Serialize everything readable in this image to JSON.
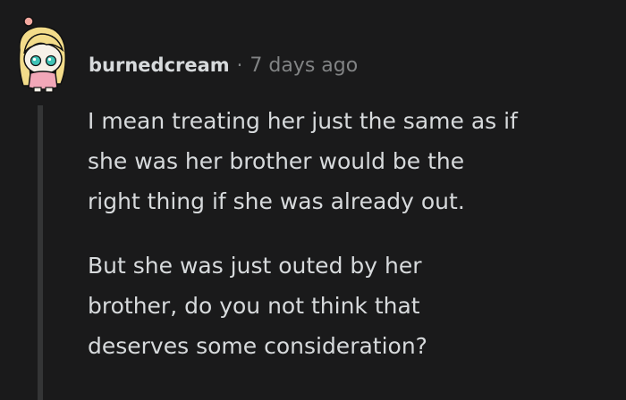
{
  "comment": {
    "author": "burnedcream",
    "separator": "·",
    "timestamp": "7 days ago",
    "avatar_icon": "snoo-avatar-blonde-icon",
    "paragraphs": [
      [
        "I mean treating her just the same as if",
        "she was her brother would be the",
        "right thing if she was already out."
      ],
      [
        "But she was just outed by her",
        "brother, do you not think that",
        "deserves some consideration?"
      ]
    ]
  },
  "colors": {
    "background": "#1a1a1b",
    "text": "#d7dadc",
    "meta": "#818384",
    "thread_line": "#343536"
  }
}
